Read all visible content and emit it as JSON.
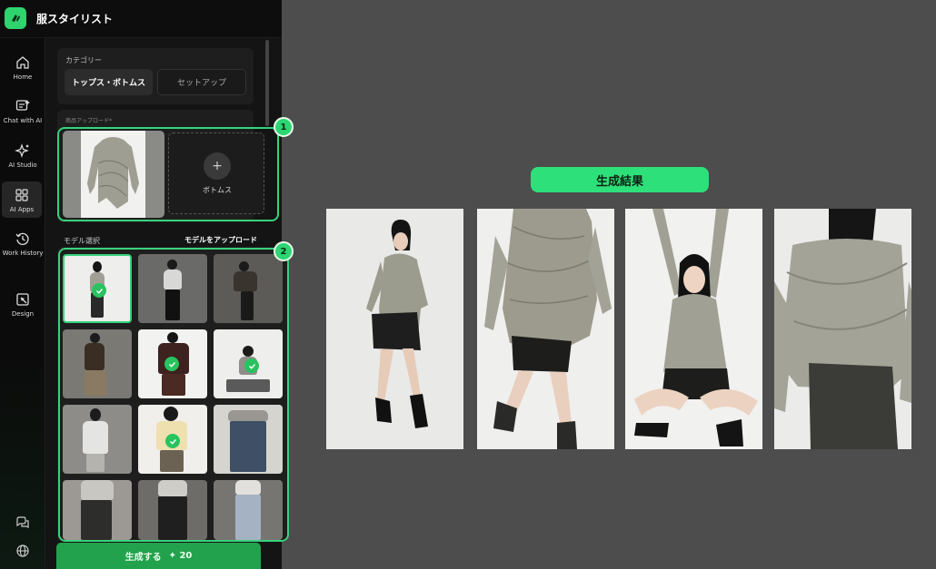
{
  "app": {
    "title": "服スタイリスト"
  },
  "nav": {
    "items": [
      {
        "label": "Home",
        "icon": "home-icon"
      },
      {
        "label": "Chat with AI",
        "icon": "chat-icon"
      },
      {
        "label": "AI Studio",
        "icon": "sparkle-icon"
      },
      {
        "label": "AI Apps",
        "icon": "grid-icon"
      },
      {
        "label": "Work History",
        "icon": "history-icon"
      },
      {
        "label": "Design",
        "icon": "design-icon"
      }
    ],
    "active": "AI Apps",
    "bottom_icons": [
      "messages-icon",
      "globe-icon"
    ]
  },
  "category": {
    "label": "カテゴリー",
    "options": [
      "トップス・ボトムス",
      "セットアップ"
    ],
    "selected": "トップス・ボトムス"
  },
  "upload": {
    "label": "商品アップロード*",
    "add_slot_label": "ボトムス"
  },
  "models": {
    "label": "モデル選択",
    "upload_link": "モデルをアップロード"
  },
  "badges": [
    "1",
    "2"
  ],
  "generate": {
    "label": "生成する",
    "cost": "✦ 20"
  },
  "result": {
    "title": "生成結果"
  },
  "colors": {
    "accent": "#2ee07a",
    "highlight_border": "#38d27b",
    "generate_button": "#23a24d",
    "background": "#4d4d4d",
    "panel": "#141414"
  }
}
